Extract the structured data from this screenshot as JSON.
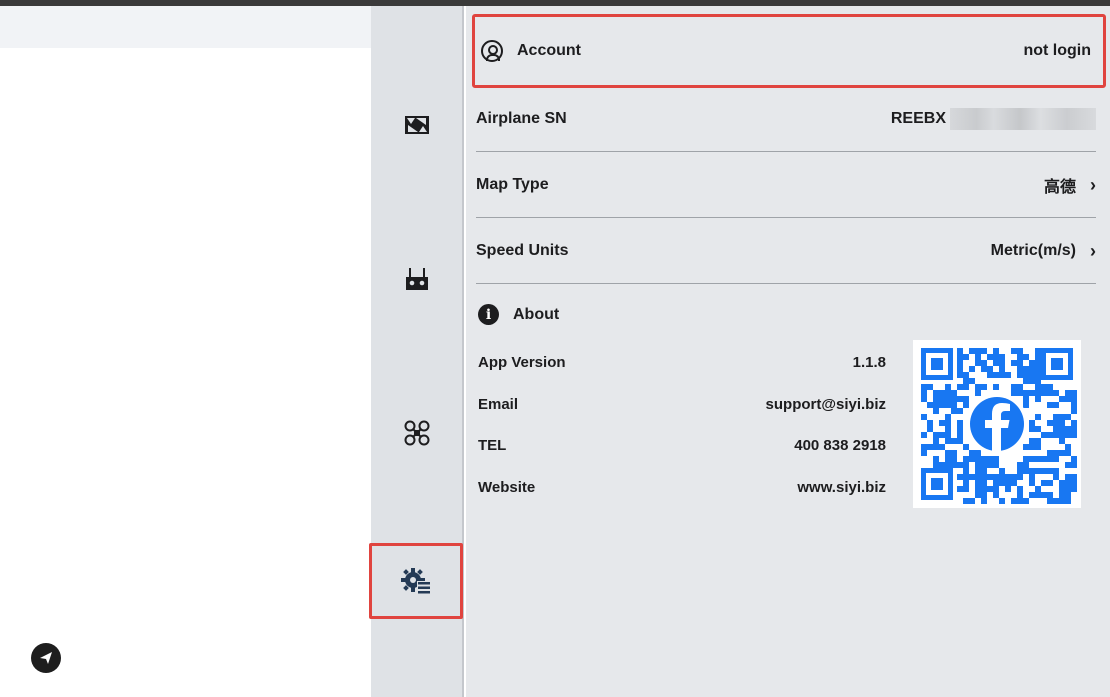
{
  "rail": {
    "items": [
      {
        "name": "camera-icon"
      },
      {
        "name": "remote-controller-icon"
      },
      {
        "name": "drone-icon"
      },
      {
        "name": "settings-gear-icon",
        "selected": true
      }
    ]
  },
  "account": {
    "label": "Account",
    "value": "not login"
  },
  "settings_rows": [
    {
      "label": "Airplane SN",
      "value": "REEBX"
    },
    {
      "label": "Map Type",
      "value": "高德"
    },
    {
      "label": "Speed Units",
      "value": "Metric(m/s)"
    }
  ],
  "about": {
    "title": "About",
    "rows": [
      {
        "label": "App Version",
        "value": "1.1.8"
      },
      {
        "label": "Email",
        "value": "support@siyi.biz"
      },
      {
        "label": "TEL",
        "value": "400 838 2918"
      },
      {
        "label": "Website",
        "value": "www.siyi.biz"
      }
    ]
  },
  "colors": {
    "highlight": "#e0443f",
    "qr_blue": "#1877f2",
    "panel": "#e6e8eb",
    "rail": "#dfe2e6"
  }
}
